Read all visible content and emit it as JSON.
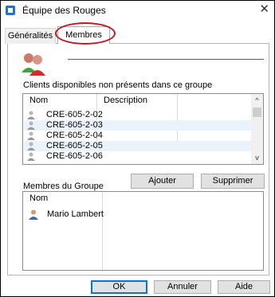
{
  "window": {
    "title": "Équipe des Rouges",
    "close_symbol": "✕"
  },
  "tabs": [
    {
      "label": "Généralités",
      "active": false
    },
    {
      "label": "Membres",
      "active": true
    }
  ],
  "available": {
    "label": "Clients disponibles non présents dans ce groupe",
    "columns": [
      "Nom",
      "Description"
    ],
    "rows": [
      {
        "name": "CRE-605-2-02",
        "description": ""
      },
      {
        "name": "CRE-605-2-03",
        "description": ""
      },
      {
        "name": "CRE-605-2-04",
        "description": ""
      },
      {
        "name": "CRE-605-2-05",
        "description": ""
      },
      {
        "name": "CRE-605-2-06",
        "description": ""
      }
    ],
    "scroll_up": "^",
    "scroll_down": "v"
  },
  "actions": {
    "add": "Ajouter",
    "remove": "Supprimer"
  },
  "members": {
    "label": "Membres du Groupe",
    "column": "Nom",
    "rows": [
      {
        "name": "Mario Lambert"
      }
    ]
  },
  "footer": {
    "ok": "OK",
    "cancel": "Annuler",
    "help": "Aide"
  },
  "colors": {
    "highlight_circle": "#c4161c",
    "row_alt": "#eaf3fb",
    "ok_border": "#0078d7"
  }
}
